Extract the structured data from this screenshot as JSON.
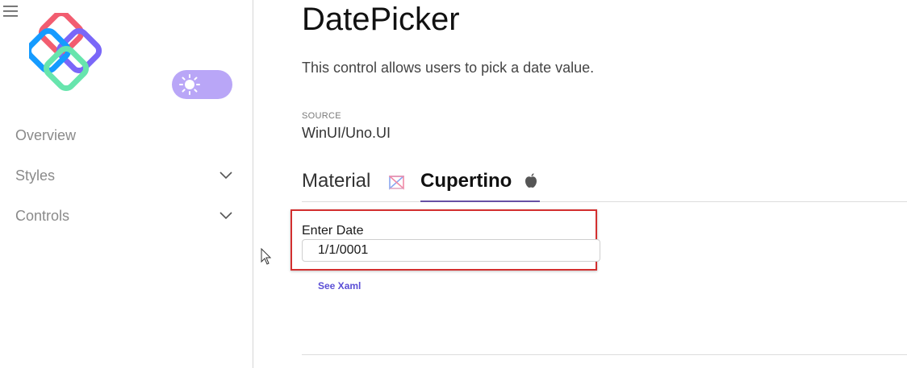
{
  "sidebar": {
    "nav_items": [
      {
        "label": "Overview",
        "expandable": false
      },
      {
        "label": "Styles",
        "expandable": true
      },
      {
        "label": "Controls",
        "expandable": true
      }
    ],
    "theme_toggle": {
      "icon": "sun-icon",
      "color": "#b9a6f7"
    }
  },
  "page": {
    "title": "DatePicker",
    "description": "This control allows users to pick a date value.",
    "source_label": "SOURCE",
    "source_value": "WinUI/Uno.UI",
    "tabs": [
      {
        "label": "Material",
        "icon": "material-icon",
        "selected": false
      },
      {
        "label": "Cupertino",
        "icon": "apple-icon",
        "selected": true
      }
    ],
    "date_picker": {
      "label": "Enter Date",
      "value": "1/1/0001"
    },
    "see_xaml": "See Xaml"
  },
  "colors": {
    "accent": "#6750a4",
    "highlight_border": "#d32f2f",
    "link": "#5b4fd6"
  }
}
